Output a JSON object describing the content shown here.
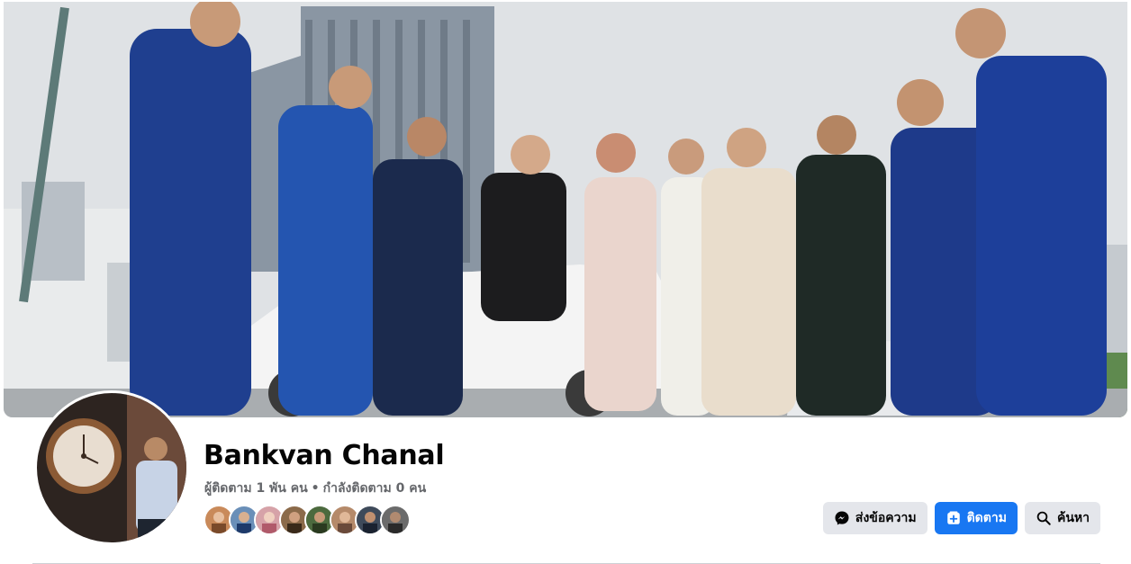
{
  "profile": {
    "name": "Bankvan Chanal",
    "followers_text": "ผู้ติดตาม 1 พัน คน",
    "separator": "•",
    "following_text": "กำลังติดตาม 0 คน"
  },
  "friends_preview": {
    "count_shown": 8,
    "colors": [
      "#c98a5a",
      "#6a8fb8",
      "#d6a2a8",
      "#8b6a4a",
      "#4c6a3e",
      "#b58a6a",
      "#3e4a5a",
      "#6b6b6b"
    ]
  },
  "actions": {
    "message_label": "ส่งข้อความ",
    "message_icon": "messenger-icon",
    "follow_label": "ติดตาม",
    "follow_icon": "follow-plus-icon",
    "search_label": "ค้นหา",
    "search_icon": "search-icon"
  },
  "colors": {
    "accent": "#1877f2",
    "secondary_button": "#e4e6eb",
    "muted_text": "#65676b"
  }
}
